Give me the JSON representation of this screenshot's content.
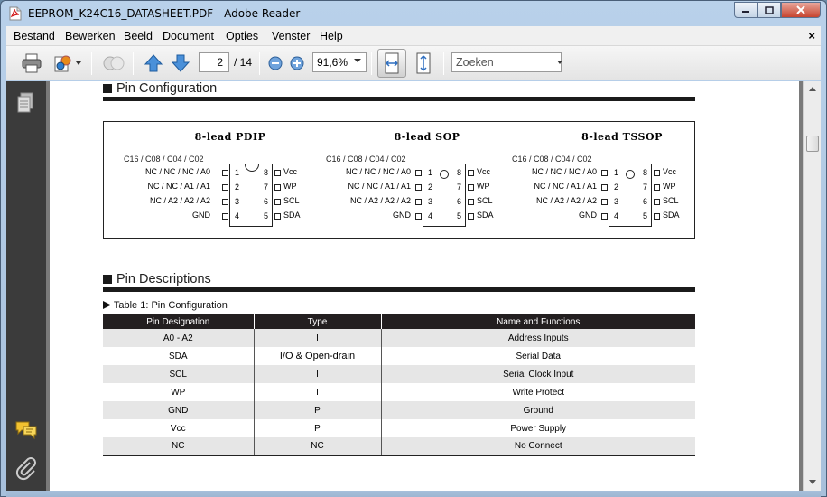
{
  "window": {
    "title": "EEPROM_K24C16_DATASHEET.PDF - Adobe Reader"
  },
  "menu": {
    "items": [
      {
        "u": "B",
        "rest": "estand"
      },
      {
        "u": "",
        "pre": "Be",
        "uc": "w",
        "rest": "erken"
      },
      {
        "u": "",
        "pre": "Bee",
        "uc": "l",
        "rest": "d"
      },
      {
        "u": "D",
        "rest": "ocument"
      },
      {
        "u": "",
        "pre": "Op",
        "uc": "t",
        "rest": "ies"
      },
      {
        "u": "V",
        "rest": "enster"
      },
      {
        "u": "H",
        "rest": "elp"
      }
    ],
    "labels": [
      "Bestand",
      "Bewerken",
      "Beeld",
      "Document",
      "Opties",
      "Venster",
      "Help"
    ],
    "close_glyph": "×"
  },
  "toolbar": {
    "page_current": "2",
    "page_total": "/ 14",
    "zoom": "91,6%",
    "search_placeholder": "Zoeken"
  },
  "document": {
    "section1_title": "Pin Configuration",
    "section2_title": "Pin Descriptions",
    "packages": [
      {
        "title": "8-lead PDIP",
        "marker": "notch"
      },
      {
        "title": "8-lead SOP",
        "marker": "dot"
      },
      {
        "title": "8-lead TSSOP",
        "marker": "dot"
      }
    ],
    "pin_header": "C16 / C08 / C04 / C02",
    "left_pins": [
      {
        "label": "NC  /  NC  /  NC  /   A0",
        "num": "1"
      },
      {
        "label": "NC  /  NC  /   A1  /   A1",
        "num": "2"
      },
      {
        "label": "NC  /   A2  /   A2  /   A2",
        "num": "3"
      },
      {
        "label": "GND",
        "num": "4"
      }
    ],
    "right_pins": [
      {
        "num": "8",
        "label": "Vcc"
      },
      {
        "num": "7",
        "label": "WP"
      },
      {
        "num": "6",
        "label": "SCL"
      },
      {
        "num": "5",
        "label": "SDA"
      }
    ],
    "table_caption": "Table 1: Pin Configuration",
    "table_columns": [
      "Pin Designation",
      "Type",
      "Name and Functions"
    ],
    "table_rows": [
      [
        "A0 - A2",
        "I",
        "Address Inputs"
      ],
      [
        "SDA",
        "I/O & Open-drain",
        "Serial Data"
      ],
      [
        "SCL",
        "I",
        "Serial Clock Input"
      ],
      [
        "WP",
        "I",
        "Write Protect"
      ],
      [
        "GND",
        "P",
        "Ground"
      ],
      [
        "Vcc",
        "P",
        "Power Supply"
      ],
      [
        "NC",
        "NC",
        "No Connect"
      ]
    ]
  }
}
